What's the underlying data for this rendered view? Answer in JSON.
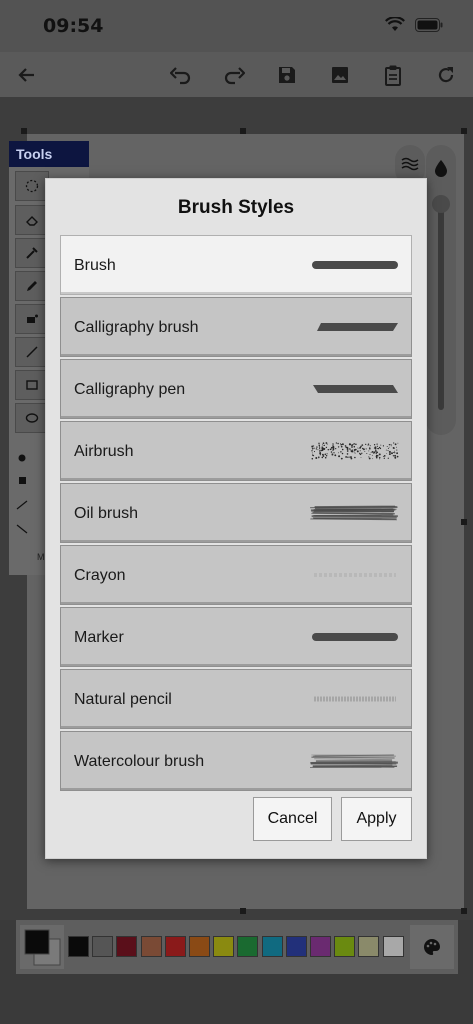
{
  "status": {
    "time": "09:54"
  },
  "tools_panel": {
    "title": "Tools",
    "partial_label": "M"
  },
  "dialog": {
    "title": "Brush Styles",
    "items": [
      {
        "label": "Brush",
        "selected": true
      },
      {
        "label": "Calligraphy brush",
        "selected": false
      },
      {
        "label": "Calligraphy pen",
        "selected": false
      },
      {
        "label": "Airbrush",
        "selected": false
      },
      {
        "label": "Oil brush",
        "selected": false
      },
      {
        "label": "Crayon",
        "selected": false
      },
      {
        "label": "Marker",
        "selected": false
      },
      {
        "label": "Natural pencil",
        "selected": false
      },
      {
        "label": "Watercolour brush",
        "selected": false
      }
    ],
    "cancel_label": "Cancel",
    "apply_label": "Apply"
  },
  "palette": {
    "colors": [
      "#0a0a0a",
      "#555555",
      "#5a0f1a",
      "#7a4a35",
      "#8a1a1a",
      "#8a4a15",
      "#8a8a10",
      "#1a6a30",
      "#106a80",
      "#22307a",
      "#6a2a70",
      "#6a8a10",
      "#8a8a6a",
      "#a8a8a8"
    ]
  },
  "toolbar_icons": [
    "back-arrow-icon",
    "undo-icon",
    "redo-icon",
    "save-icon",
    "image-icon",
    "clipboard-icon",
    "refresh-icon"
  ]
}
